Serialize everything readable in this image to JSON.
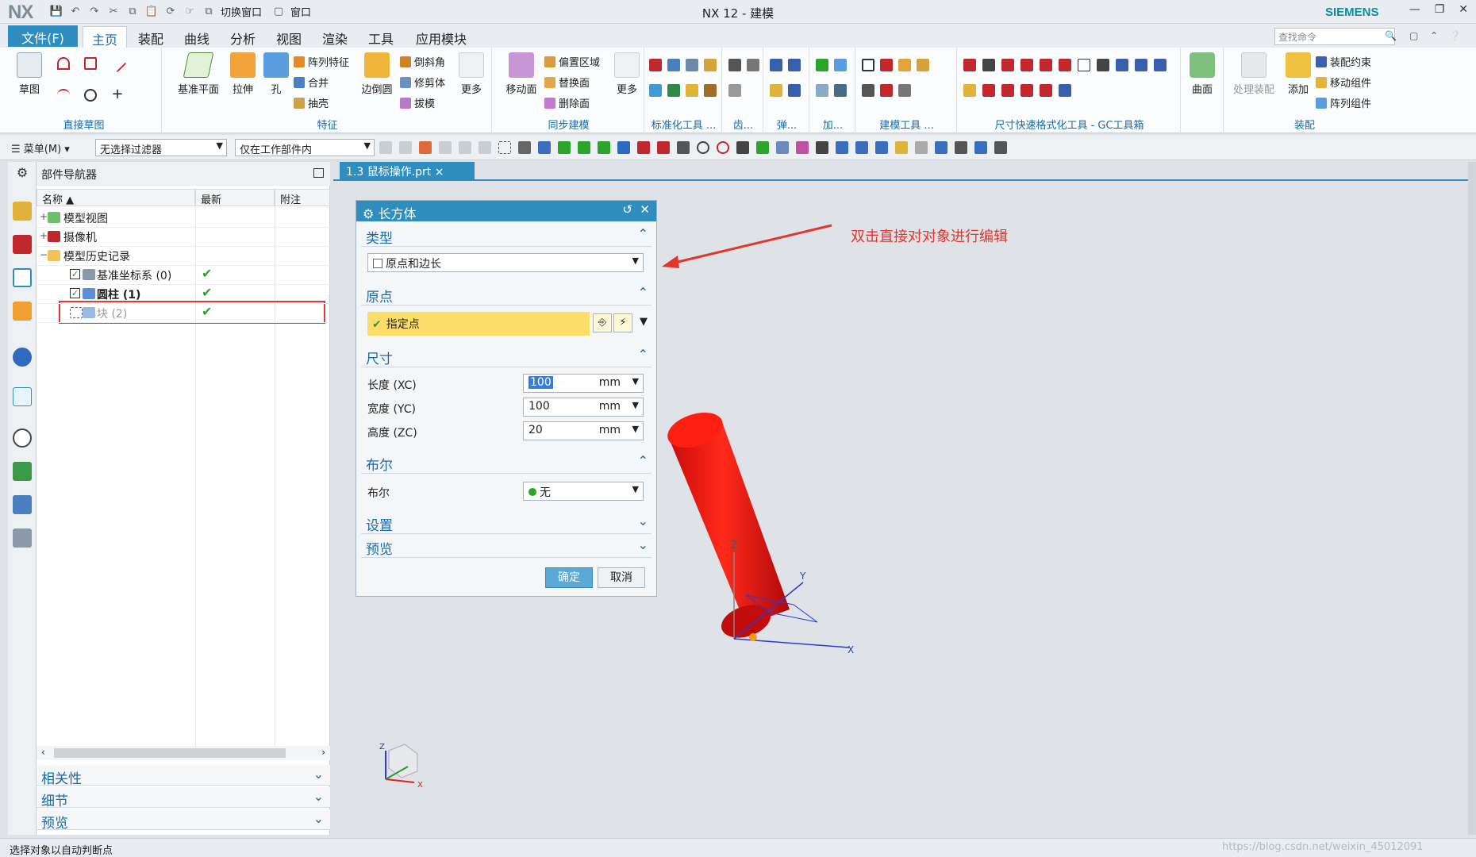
{
  "app": {
    "logo": "NX",
    "title": "NX 12 - 建模",
    "brand": "SIEMENS",
    "quick_access": {
      "switch_window": "切换窗口",
      "window": "窗口"
    }
  },
  "tabs": [
    "文件(F)",
    "主页",
    "装配",
    "曲线",
    "分析",
    "视图",
    "渲染",
    "工具",
    "应用模块"
  ],
  "active_tab": "主页",
  "search": {
    "placeholder": "查找命令"
  },
  "ribbon": {
    "direct_sketch": {
      "name": "直接草图",
      "sketch": "草图"
    },
    "feature": {
      "name": "特征",
      "datum_plane": "基准平面",
      "extrude": "拉伸",
      "hole": "孔",
      "pattern_feature": "阵列特征",
      "unite": "合并",
      "shell": "抽壳",
      "edge_blend": "边倒圆",
      "chamfer": "倒斜角",
      "trim_body": "修剪体",
      "draft": "拔模",
      "more": "更多"
    },
    "sync": {
      "name": "同步建模",
      "move_face": "移动面",
      "offset_region": "偏置区域",
      "replace_face": "替换面",
      "delete_face": "删除面",
      "more": "更多"
    },
    "std_tools": {
      "name": "标准化工具 ..."
    },
    "gear": {
      "name": "齿..."
    },
    "spring": {
      "name": "弹..."
    },
    "add": {
      "name": "加..."
    },
    "model_tools": {
      "name": "建模工具 ..."
    },
    "dim_format": {
      "name": "尺寸快速格式化工具 - GC工具箱"
    },
    "surface": {
      "label": "曲面"
    },
    "assembly": {
      "name": "装配",
      "process": "处理装配",
      "add": "添加",
      "constraint": "装配约束",
      "move_comp": "移动组件",
      "pattern_comp": "阵列组件"
    }
  },
  "filterbar": {
    "menu": "菜单(M)",
    "filter": "无选择过滤器",
    "scope": "仅在工作部件内"
  },
  "navigator": {
    "title": "部件导航器",
    "columns": [
      "名称",
      "最新",
      "附注"
    ],
    "rows": [
      {
        "label": "模型视图",
        "level": 0,
        "expand": "+",
        "latest": ""
      },
      {
        "label": "摄像机",
        "level": 0,
        "expand": "+",
        "latest": ""
      },
      {
        "label": "模型历史记录",
        "level": 0,
        "expand": "−",
        "latest": ""
      },
      {
        "label": "基准坐标系 (0)",
        "level": 1,
        "expand": "",
        "latest": "✔"
      },
      {
        "label": "圆柱 (1)",
        "level": 1,
        "expand": "",
        "latest": "✔"
      },
      {
        "label": "块 (2)",
        "level": 1,
        "expand": "",
        "latest": "✔"
      }
    ],
    "panels": [
      "相关性",
      "细节",
      "预览"
    ]
  },
  "document_tab": "1.3 鼠标操作.prt",
  "dialog": {
    "title": "长方体",
    "type_section": "类型",
    "type_value": "原点和边长",
    "origin_section": "原点",
    "specify_point": "指定点",
    "dims_section": "尺寸",
    "length_label": "长度 (XC)",
    "length_value": "100",
    "width_label": "宽度 (YC)",
    "width_value": "100",
    "height_label": "高度 (ZC)",
    "height_value": "20",
    "unit": "mm",
    "boolean_section": "布尔",
    "boolean_label": "布尔",
    "boolean_value": "无",
    "settings_section": "设置",
    "preview_section": "预览",
    "ok": "确定",
    "cancel": "取消"
  },
  "annotation": "双击直接对对象进行编辑",
  "axes": {
    "x": "X",
    "y": "Y",
    "z": "Z"
  },
  "status": "选择对象以自动判断点",
  "watermark": "https://blog.csdn.net/weixin_45012091",
  "colors": {
    "accent": "#2f8ebf",
    "cylinder": "#e00d0d",
    "highlight": "#fddd6a",
    "annotation": "#e0362c"
  }
}
